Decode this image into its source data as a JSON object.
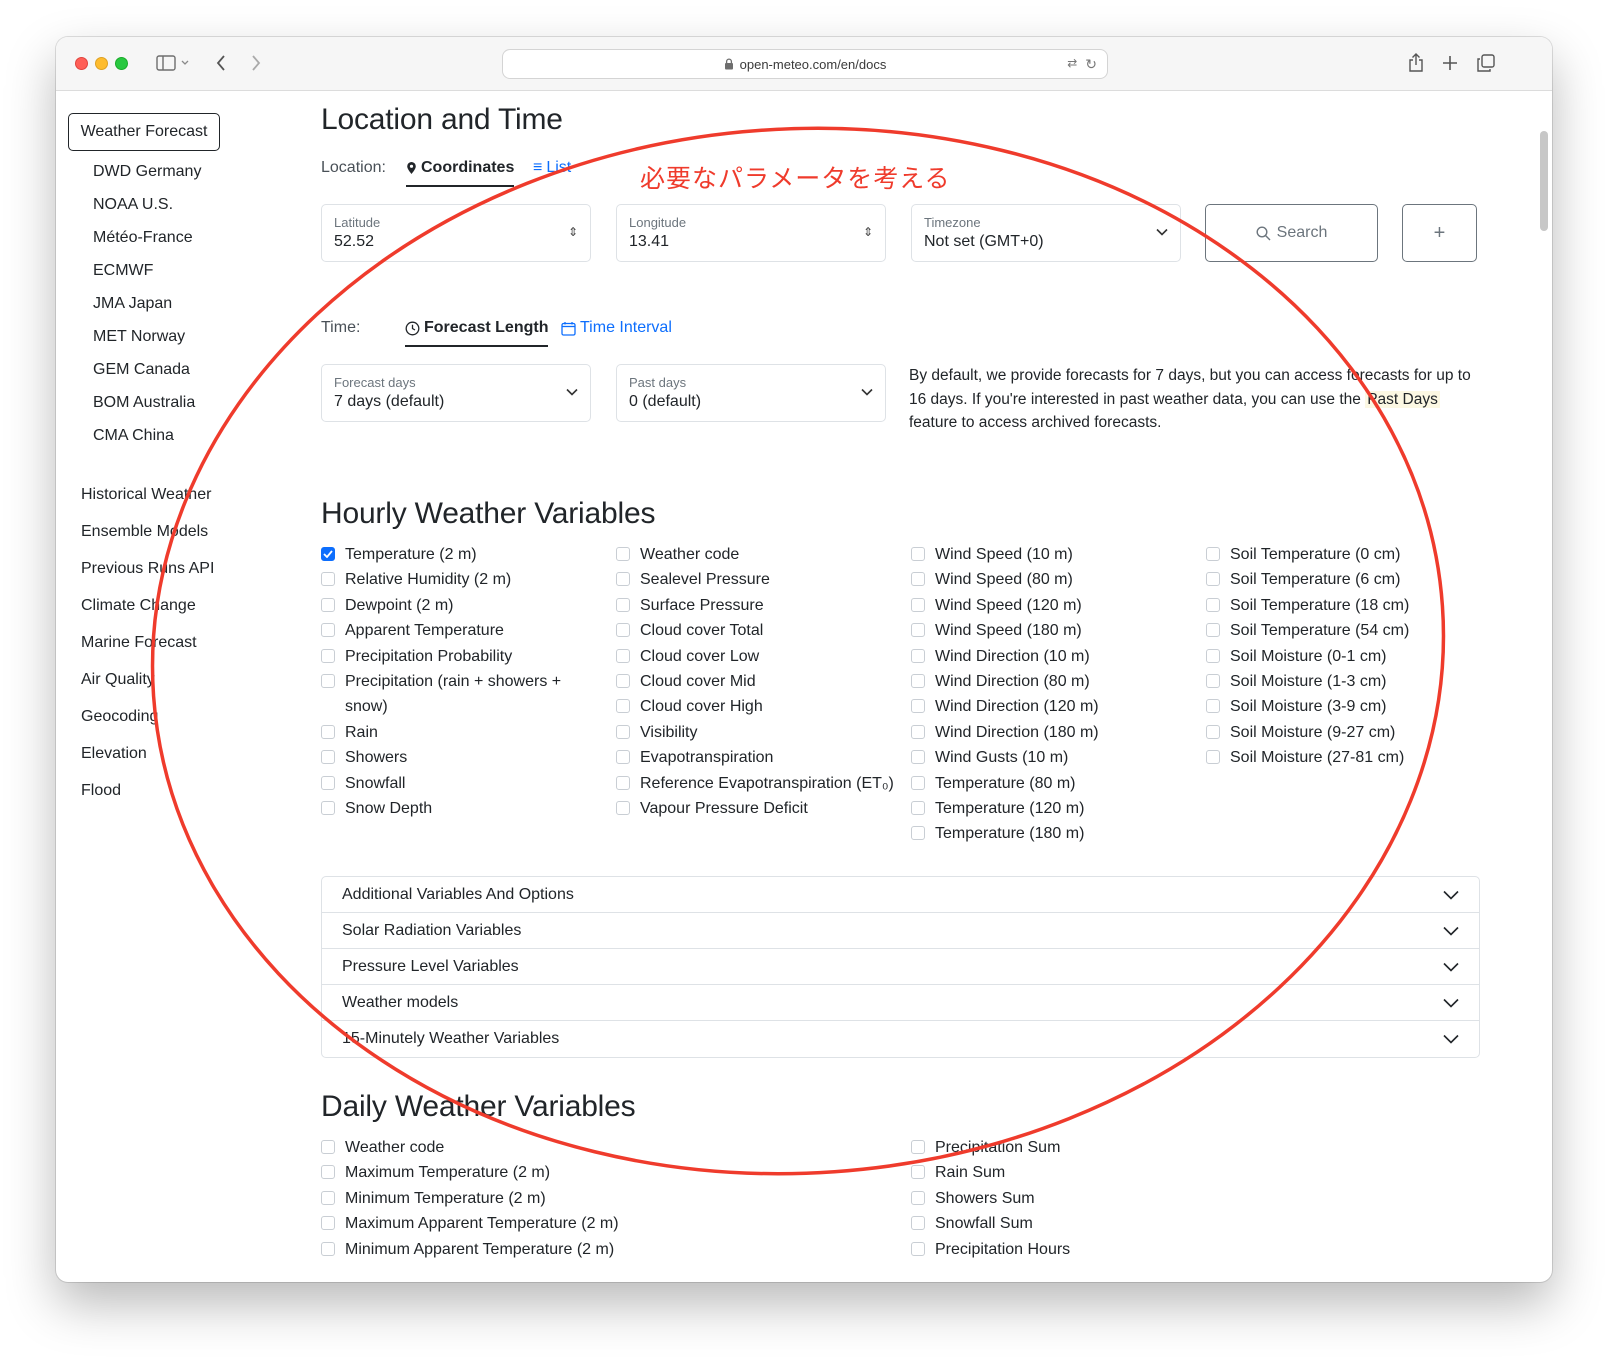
{
  "browser": {
    "url": "open-meteo.com/en/docs"
  },
  "sidebar": {
    "active": "Weather Forecast",
    "sub_items": [
      "DWD Germany",
      "NOAA U.S.",
      "Météo-France",
      "ECMWF",
      "JMA Japan",
      "MET Norway",
      "GEM Canada",
      "BOM Australia",
      "CMA China"
    ],
    "items": [
      "Historical Weather",
      "Ensemble Models",
      "Previous Runs API",
      "Climate Change",
      "Marine Forecast",
      "Air Quality",
      "Geocoding",
      "Elevation",
      "Flood"
    ]
  },
  "location_time": {
    "title": "Location and Time",
    "location_label": "Location:",
    "tab_coordinates": "Coordinates",
    "tab_list": "List",
    "latitude_label": "Latitude",
    "latitude_value": "52.52",
    "longitude_label": "Longitude",
    "longitude_value": "13.41",
    "timezone_label": "Timezone",
    "timezone_value": "Not set (GMT+0)",
    "search_label": "Search",
    "add_label": "+",
    "time_label": "Time:",
    "tab_forecast_length": "Forecast Length",
    "tab_time_interval": "Time Interval",
    "forecast_days_label": "Forecast days",
    "forecast_days_value": "7 days (default)",
    "past_days_label": "Past days",
    "past_days_value": "0 (default)",
    "info_before": "By default, we provide forecasts for 7 days, but you can access forecasts for up to 16 days. If you're interested in past weather data, you can use the ",
    "info_highlight": "Past Days",
    "info_after": " feature to access archived forecasts."
  },
  "annotation": {
    "text": "必要なパラメータを考える",
    "color": "#ef3b2c"
  },
  "hourly": {
    "title": "Hourly Weather Variables",
    "col1": [
      {
        "label": "Temperature (2 m)",
        "checked": true
      },
      {
        "label": "Relative Humidity (2 m)",
        "checked": false
      },
      {
        "label": "Dewpoint (2 m)",
        "checked": false
      },
      {
        "label": "Apparent Temperature",
        "checked": false
      },
      {
        "label": "Precipitation Probability",
        "checked": false
      },
      {
        "label": "Precipitation (rain + showers +",
        "checked": false
      },
      {
        "label": "snow)",
        "checked": false
      },
      {
        "label": "Rain",
        "checked": false
      },
      {
        "label": "Showers",
        "checked": false
      },
      {
        "label": "Snowfall",
        "checked": false
      },
      {
        "label": "Snow Depth",
        "checked": false
      }
    ],
    "col2": [
      {
        "label": "Weather code",
        "checked": false
      },
      {
        "label": "Sealevel Pressure",
        "checked": false
      },
      {
        "label": "Surface Pressure",
        "checked": false
      },
      {
        "label": "Cloud cover Total",
        "checked": false
      },
      {
        "label": "Cloud cover Low",
        "checked": false
      },
      {
        "label": "Cloud cover Mid",
        "checked": false
      },
      {
        "label": "Cloud cover High",
        "checked": false
      },
      {
        "label": "Visibility",
        "checked": false
      },
      {
        "label": "Evapotranspiration",
        "checked": false
      },
      {
        "label": "Reference Evapotranspiration (ET₀)",
        "checked": false
      },
      {
        "label": "Vapour Pressure Deficit",
        "checked": false
      }
    ],
    "col3": [
      {
        "label": "Wind Speed (10 m)",
        "checked": false
      },
      {
        "label": "Wind Speed (80 m)",
        "checked": false
      },
      {
        "label": "Wind Speed (120 m)",
        "checked": false
      },
      {
        "label": "Wind Speed (180 m)",
        "checked": false
      },
      {
        "label": "Wind Direction (10 m)",
        "checked": false
      },
      {
        "label": "Wind Direction (80 m)",
        "checked": false
      },
      {
        "label": "Wind Direction (120 m)",
        "checked": false
      },
      {
        "label": "Wind Direction (180 m)",
        "checked": false
      },
      {
        "label": "Wind Gusts (10 m)",
        "checked": false
      },
      {
        "label": "Temperature (80 m)",
        "checked": false
      },
      {
        "label": "Temperature (120 m)",
        "checked": false
      },
      {
        "label": "Temperature (180 m)",
        "checked": false
      }
    ],
    "col4": [
      {
        "label": "Soil Temperature (0 cm)",
        "checked": false
      },
      {
        "label": "Soil Temperature (6 cm)",
        "checked": false
      },
      {
        "label": "Soil Temperature (18 cm)",
        "checked": false
      },
      {
        "label": "Soil Temperature (54 cm)",
        "checked": false
      },
      {
        "label": "Soil Moisture (0-1 cm)",
        "checked": false
      },
      {
        "label": "Soil Moisture (1-3 cm)",
        "checked": false
      },
      {
        "label": "Soil Moisture (3-9 cm)",
        "checked": false
      },
      {
        "label": "Soil Moisture (9-27 cm)",
        "checked": false
      },
      {
        "label": "Soil Moisture (27-81 cm)",
        "checked": false
      }
    ]
  },
  "accordion": [
    "Additional Variables And Options",
    "Solar Radiation Variables",
    "Pressure Level Variables",
    "Weather models",
    "15-Minutely Weather Variables"
  ],
  "daily": {
    "title": "Daily Weather Variables",
    "col1": [
      "Weather code",
      "Maximum Temperature (2 m)",
      "Minimum Temperature (2 m)",
      "Maximum Apparent Temperature (2 m)",
      "Minimum Apparent Temperature (2 m)"
    ],
    "col2": [
      "Precipitation Sum",
      "Rain Sum",
      "Showers Sum",
      "Snowfall Sum",
      "Precipitation Hours"
    ]
  }
}
